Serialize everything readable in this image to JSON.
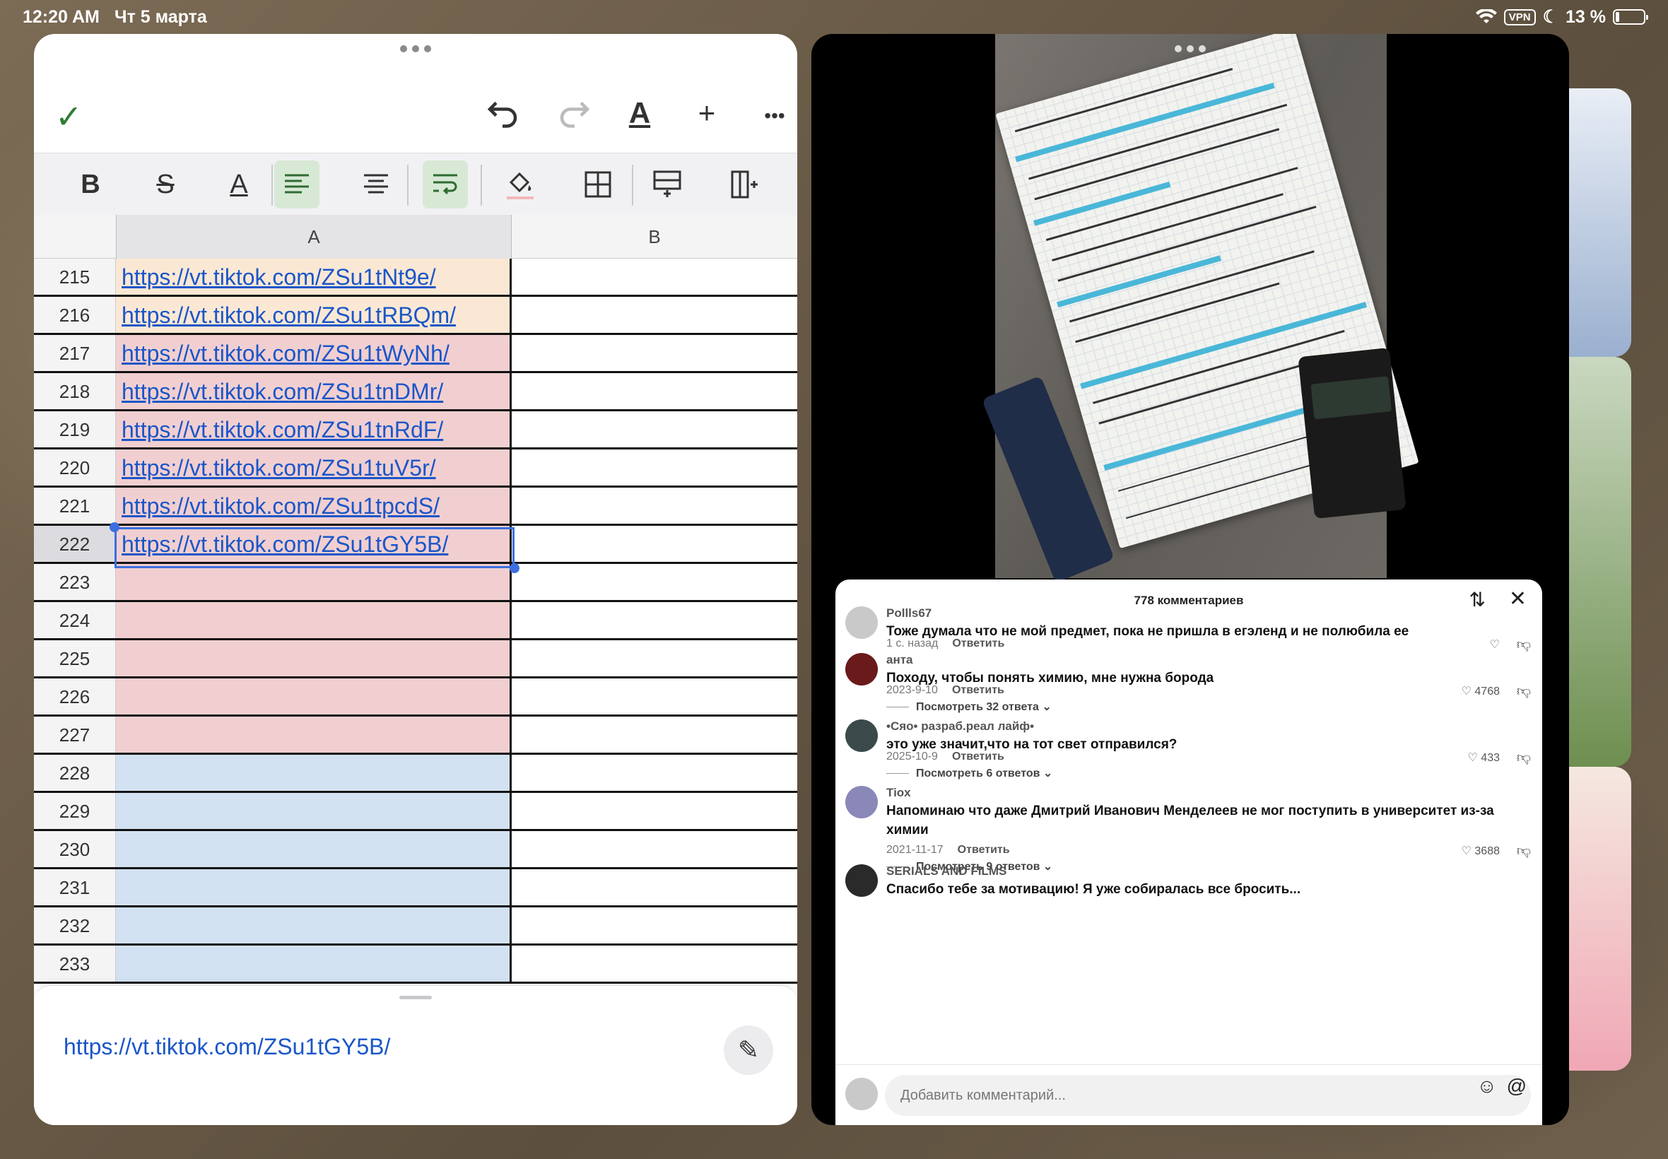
{
  "status": {
    "time": "12:20 AM",
    "date": "Чт 5 марта",
    "vpn": "VPN",
    "battery": "13 %",
    "icons": [
      "wifi-icon",
      "moon-icon"
    ]
  },
  "sheet": {
    "toolbar": {
      "undo": "undo-icon",
      "redo": "redo-icon",
      "text_format": "A",
      "add": "+",
      "more": "•••"
    },
    "columns": [
      "A",
      "B"
    ],
    "rows": [
      {
        "num": "215",
        "value": "https://vt.tiktok.com/ZSu1tNt9e/",
        "color": "#fbe8d4"
      },
      {
        "num": "216",
        "value": "https://vt.tiktok.com/ZSu1tRBQm/",
        "color": "#fbe8d4"
      },
      {
        "num": "217",
        "value": "https://vt.tiktok.com/ZSu1tWyNh/",
        "color": "#f1cfd0"
      },
      {
        "num": "218",
        "value": "https://vt.tiktok.com/ZSu1tnDMr/",
        "color": "#f1cfd0"
      },
      {
        "num": "219",
        "value": "https://vt.tiktok.com/ZSu1tnRdF/",
        "color": "#f1cfd0"
      },
      {
        "num": "220",
        "value": "https://vt.tiktok.com/ZSu1tuV5r/",
        "color": "#f1cfd0"
      },
      {
        "num": "221",
        "value": "https://vt.tiktok.com/ZSu1tpcdS/",
        "color": "#f1cfd0"
      },
      {
        "num": "222",
        "value": "https://vt.tiktok.com/ZSu1tGY5B/",
        "color": "#f1cfd0"
      },
      {
        "num": "223",
        "value": "",
        "color": "#f1cfd0"
      },
      {
        "num": "224",
        "value": "",
        "color": "#f1cfd0"
      },
      {
        "num": "225",
        "value": "",
        "color": "#f1cfd0"
      },
      {
        "num": "226",
        "value": "",
        "color": "#f1cfd0"
      },
      {
        "num": "227",
        "value": "",
        "color": "#f1cfd0"
      },
      {
        "num": "228",
        "value": "",
        "color": "#d3e2f2"
      },
      {
        "num": "229",
        "value": "",
        "color": "#d3e2f2"
      },
      {
        "num": "230",
        "value": "",
        "color": "#d3e2f2"
      },
      {
        "num": "231",
        "value": "",
        "color": "#d3e2f2"
      },
      {
        "num": "232",
        "value": "",
        "color": "#d3e2f2"
      },
      {
        "num": "233",
        "value": "",
        "color": "#d3e2f2"
      }
    ],
    "selected_row": "222",
    "editor_value": "https://vt.tiktok.com/ZSu1tGY5B/"
  },
  "comments": {
    "title": "778 комментариев",
    "reply_label": "Ответить",
    "items": [
      {
        "user": "Pollls67",
        "text": "Тоже думала что не мой предмет, пока не пришла в егэленд и не полюбила ее",
        "date": "1 с. назад",
        "likes": "",
        "replies": "",
        "avatar": "#c9c9c9"
      },
      {
        "user": "анта",
        "text": "Походу, чтобы понять химию, мне нужна борода",
        "date": "2023-9-10",
        "likes": "4768",
        "replies": "Посмотреть 32 ответа",
        "avatar": "#6a1a1a"
      },
      {
        "user": "•Сяо• разраб.реал лайф•",
        "text": "это уже значит,что на тот свет отправился?",
        "date": "2025-10-9",
        "likes": "433",
        "replies": "Посмотреть 6 ответов",
        "avatar": "#3a4a4a"
      },
      {
        "user": "Tiox",
        "text": "Напоминаю что даже Дмитрий Иванович Менделеев не мог поступить в университет из-за химии",
        "date": "2021-11-17",
        "likes": "3688",
        "replies": "Посмотреть 9 ответов",
        "avatar": "#8a88b8"
      },
      {
        "user": "SERIALS AND FILMS",
        "text": "Спасибо тебе за мотивацию! Я уже собиралась все бросить...",
        "date": "",
        "likes": "",
        "replies": "",
        "avatar": "#2a2a2a"
      }
    ],
    "input_placeholder": "Добавить комментарий..."
  }
}
